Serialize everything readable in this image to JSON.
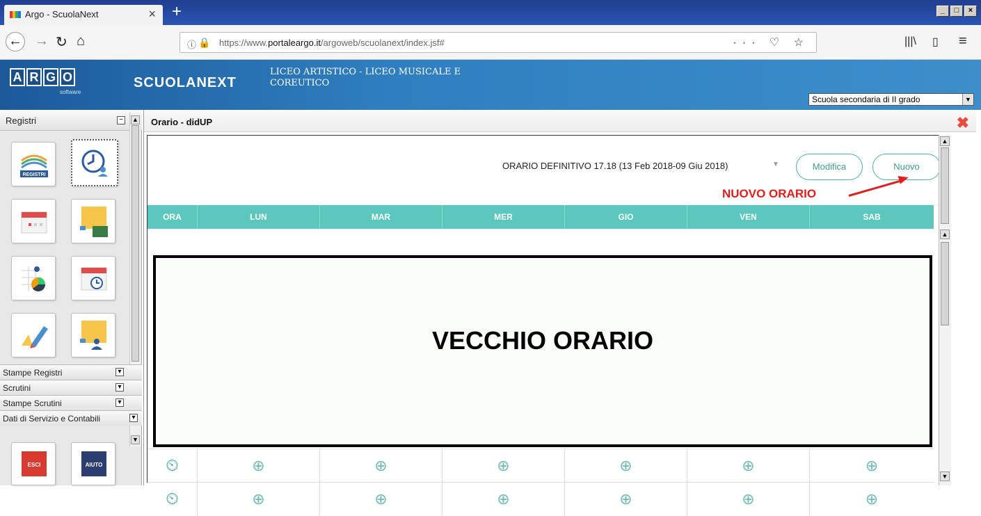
{
  "browser": {
    "tab_title": "Argo - ScuolaNext",
    "tab_close": "×",
    "new_tab": "+",
    "url_prefix": "https://www.",
    "url_domain": "portaleargo.it",
    "url_path": "/argoweb/scuolanext/index.jsf#",
    "url_actions": "··· ♡ ☆",
    "window_buttons": [
      "_",
      "□",
      "×"
    ]
  },
  "app": {
    "logo_letters": [
      "A",
      "R",
      "G",
      "O"
    ],
    "logo_sub": "software",
    "brand": "SCUOLANEXT",
    "school_name": "LICEO ARTISTICO - LICEO MUSICALE E COREUTICO",
    "grade_selected": "Scuola secondaria di II grado"
  },
  "sidebar": {
    "header": "Registri",
    "sections": [
      "Stampe Registri",
      "Scrutini",
      "Stampe Scrutini",
      "Dati di Servizio e Contabili"
    ],
    "registri_label": "REGISTRI",
    "esci_label": "ESCI",
    "aiuto_label": "AIUTO"
  },
  "panel": {
    "title": "Orario - didUP",
    "schedule_selected": "ORARIO DEFINITIVO 17.18 (13 Feb 2018-09 Giu 2018)",
    "modifica_label": "Modifica",
    "nuovo_label": "Nuovo",
    "annotation_new": "NUOVO ORARIO",
    "annotation_old": "VECCHIO ORARIO",
    "columns": [
      "ORA",
      "LUN",
      "MAR",
      "MER",
      "GIO",
      "VEN",
      "SAB"
    ],
    "row_icon": "⊕"
  },
  "colors": {
    "teal_header": "#5cc7bc",
    "annotation_red": "#e21d1d",
    "blue_header": "#2f7fc0"
  }
}
